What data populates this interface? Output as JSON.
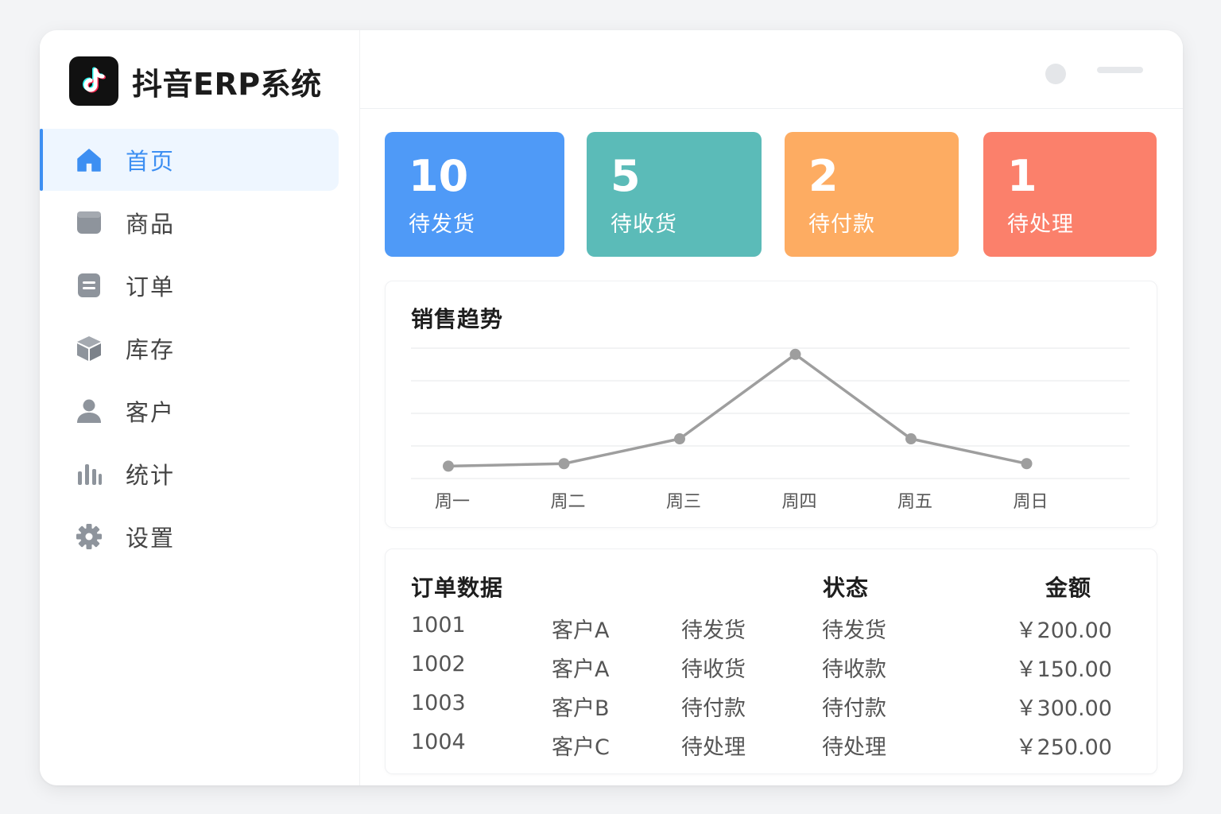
{
  "app": {
    "title": "抖音ERP系统",
    "logo_icon": "tiktok-note-icon"
  },
  "sidebar": {
    "items": [
      {
        "label": "首页",
        "icon": "home-icon",
        "active": true
      },
      {
        "label": "商品",
        "icon": "box-square-icon",
        "active": false
      },
      {
        "label": "订单",
        "icon": "document-icon",
        "active": false
      },
      {
        "label": "库存",
        "icon": "cube-icon",
        "active": false
      },
      {
        "label": "客户",
        "icon": "user-icon",
        "active": false
      },
      {
        "label": "统计",
        "icon": "bar-chart-icon",
        "active": false
      },
      {
        "label": "设置",
        "icon": "gear-icon",
        "active": false
      }
    ]
  },
  "stats": [
    {
      "value": "10",
      "label": "待发货",
      "color": "#4f9af7"
    },
    {
      "value": "5",
      "label": "待收货",
      "color": "#5bbbb8"
    },
    {
      "value": "2",
      "label": "待付款",
      "color": "#fdac62"
    },
    {
      "value": "1",
      "label": "待处理",
      "color": "#fb806b"
    }
  ],
  "sales_panel": {
    "title": "销售趋势"
  },
  "chart_data": {
    "type": "line",
    "title": "销售趋势",
    "categories": [
      "周一",
      "周二",
      "周三",
      "周四",
      "周五",
      "周日"
    ],
    "series": [
      {
        "values": [
          0.1,
          0.12,
          0.32,
          1.0,
          0.32,
          0.12
        ]
      }
    ],
    "ylim": [
      0,
      1.05
    ],
    "grid": true,
    "line_color": "#9e9e9e"
  },
  "orders": {
    "title": "订单数据",
    "col_status": "状态",
    "col_amount": "金额",
    "rows": [
      {
        "id": "1001",
        "customer": "客户A",
        "stage": "待发货",
        "status": "待发货",
        "amount": "￥200.00"
      },
      {
        "id": "1002",
        "customer": "客户A",
        "stage": "待收货",
        "status": "待收款",
        "amount": "￥150.00"
      },
      {
        "id": "1003",
        "customer": "客户B",
        "stage": "待付款",
        "status": "待付款",
        "amount": "￥300.00"
      },
      {
        "id": "1004",
        "customer": "客户C",
        "stage": "待处理",
        "status": "待处理",
        "amount": "￥250.00"
      }
    ]
  }
}
